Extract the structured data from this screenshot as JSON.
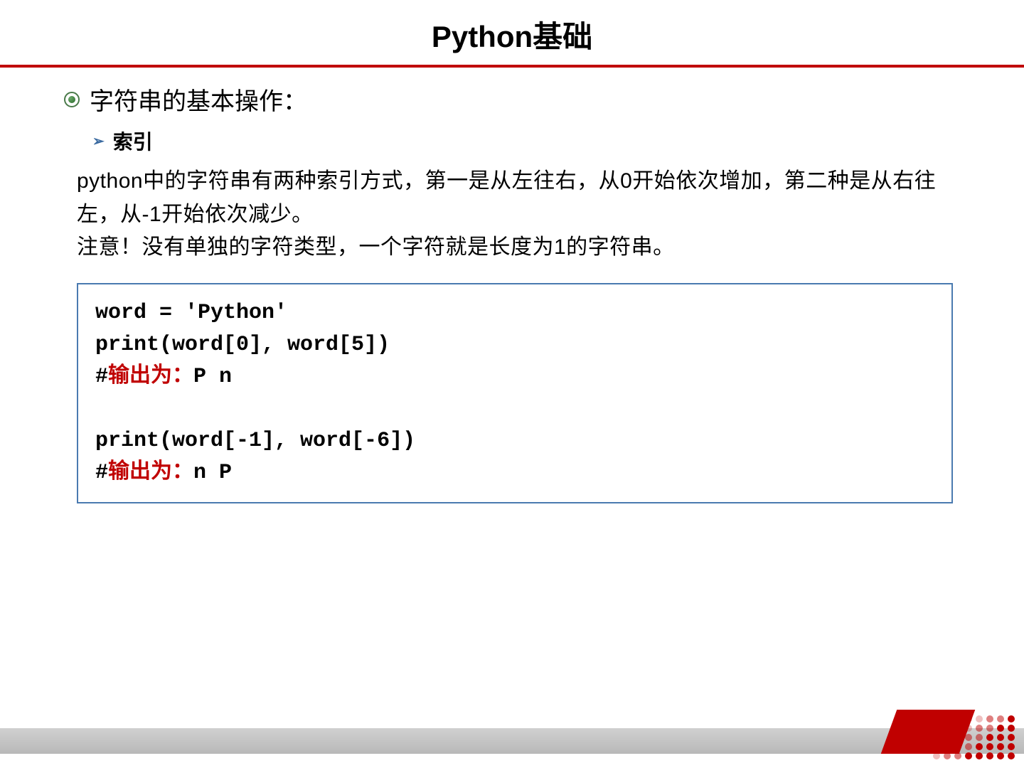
{
  "title": "Python基础",
  "main_bullet": "字符串的基本操作：",
  "sub_bullet": "索引",
  "body_paragraphs": {
    "p1": "python中的字符串有两种索引方式，第一是从左往右，从0开始依次增加，第二种是从右往左，从-1开始依次减少。",
    "p2": "注意！没有单独的字符类型，一个字符就是长度为1的字符串。"
  },
  "code": {
    "line1": "word = 'Python'",
    "line2": "print(word[0], word[5])",
    "comment1_hash": "#",
    "comment1_red": "输出为：",
    "comment1_out": "P n",
    "line3": "print(word[-1], word[-6])",
    "comment2_hash": "#",
    "comment2_red": "输出为：",
    "comment2_out": "n P"
  }
}
